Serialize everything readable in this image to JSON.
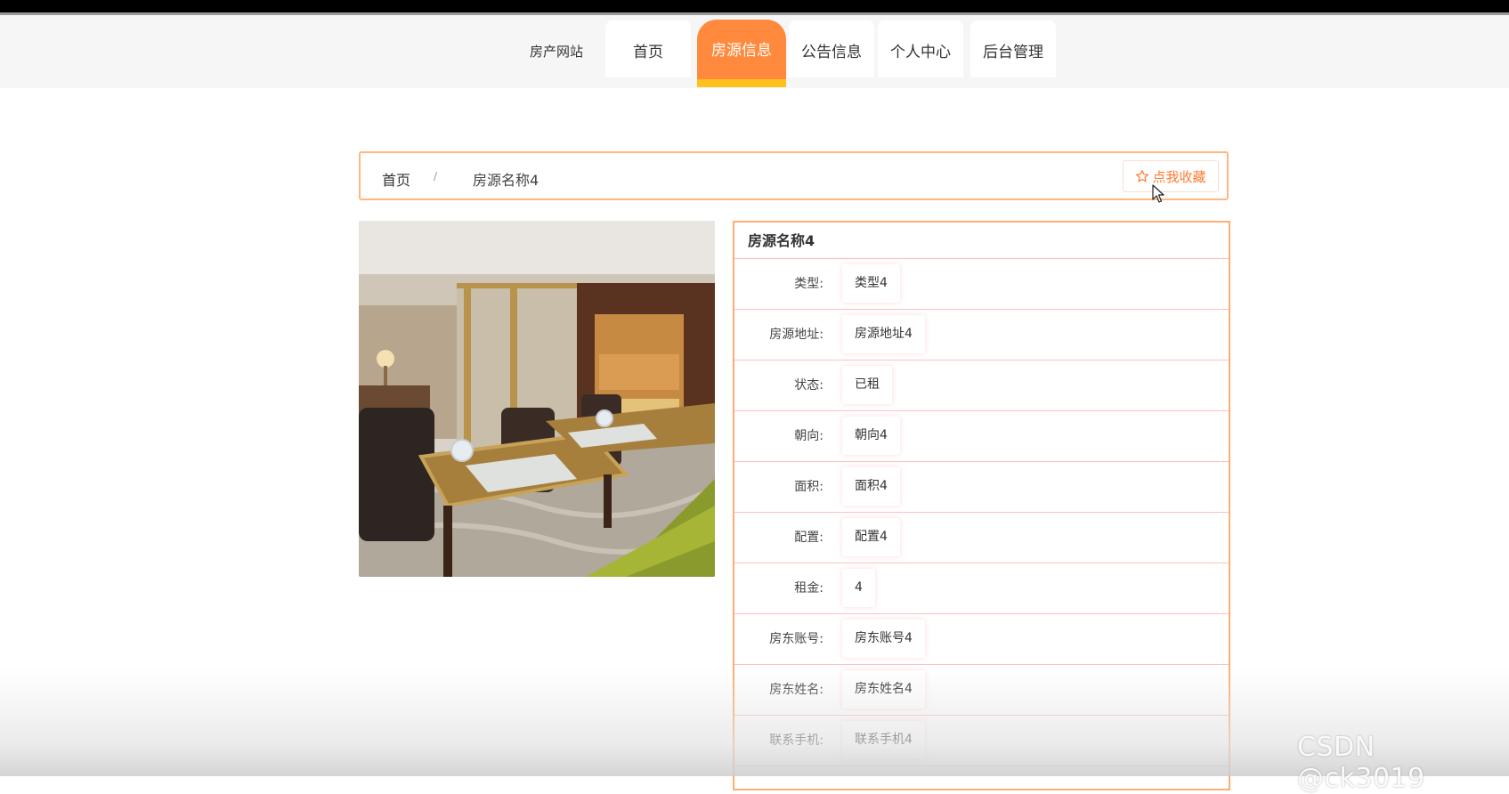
{
  "nav": {
    "brand": "房产网站",
    "items": [
      {
        "label": "首页",
        "active": false
      },
      {
        "label": "房源信息",
        "active": true
      },
      {
        "label": "公告信息",
        "active": false
      },
      {
        "label": "个人中心",
        "active": false
      },
      {
        "label": "后台管理",
        "active": false
      }
    ]
  },
  "breadcrumb": {
    "home": "首页",
    "separator": "/",
    "current": "房源名称4"
  },
  "favorite_button": {
    "icon": "star-outline-icon",
    "label": "点我收藏"
  },
  "property": {
    "title": "房源名称4",
    "image": "dining-room-photo",
    "fields": [
      {
        "label": "类型:",
        "value": "类型4"
      },
      {
        "label": "房源地址:",
        "value": "房源地址4"
      },
      {
        "label": "状态:",
        "value": "已租"
      },
      {
        "label": "朝向:",
        "value": "朝向4"
      },
      {
        "label": "面积:",
        "value": "面积4"
      },
      {
        "label": "配置:",
        "value": "配置4"
      },
      {
        "label": "租金:",
        "value": "4"
      },
      {
        "label": "房东账号:",
        "value": "房东账号4"
      },
      {
        "label": "房东姓名:",
        "value": "房东姓名4"
      },
      {
        "label": "联系手机:",
        "value": "联系手机4"
      }
    ]
  },
  "watermark": "CSDN @ck3019",
  "colors": {
    "accent": "#ff8a3d",
    "accent_underline": "#ffc21c",
    "border": "#ffae72",
    "row_border": "#ffc0c0"
  }
}
